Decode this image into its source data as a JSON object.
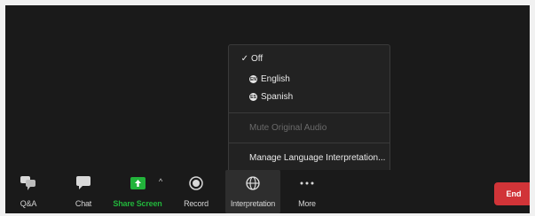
{
  "toolbar": {
    "qa_label": "Q&A",
    "chat_label": "Chat",
    "share_label": "Share Screen",
    "record_label": "Record",
    "interpretation_label": "Interpretation",
    "more_label": "More",
    "end_label": "End"
  },
  "menu": {
    "off_label": "Off",
    "english_label": "English",
    "english_badge": "EN",
    "spanish_label": "Spanish",
    "spanish_badge": "ES",
    "mute_label": "Mute Original Audio",
    "manage_label": "Manage Language Interpretation..."
  },
  "colors": {
    "share_green": "#22b43b",
    "end_red": "#d13438"
  }
}
